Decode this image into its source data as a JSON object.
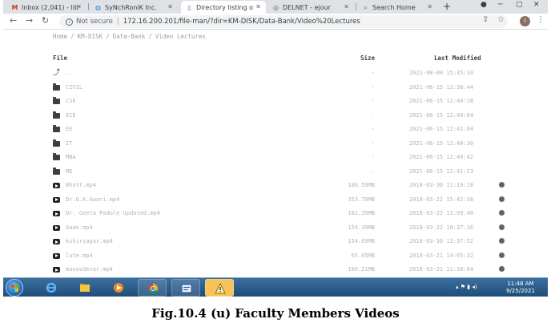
{
  "browser": {
    "tabs": [
      {
        "title": "Inbox (2,041) - lib",
        "favicon": "gmail-icon",
        "active": false
      },
      {
        "title": "SyNchRoniK Inc.",
        "favicon": "ovals-icon",
        "active": false
      },
      {
        "title": "Directory listing o",
        "favicon": "page-icon",
        "active": true
      },
      {
        "title": "DELNET - ejour",
        "favicon": "globe-icon",
        "active": false
      },
      {
        "title": "Search Home",
        "favicon": "search-icon",
        "active": false
      }
    ],
    "new_tab_label": "+",
    "security_label": "Not secure",
    "url": "172.16.200.201/file-man/?dir=KM-DISK/Data-Bank/Video%20Lectures",
    "profile_initial": "I"
  },
  "breadcrumb": [
    "Home",
    "KM-DISK",
    "Data-Bank",
    "Video Lectures"
  ],
  "table": {
    "headers": {
      "name": "File",
      "size": "Size",
      "modified": "Last Modified"
    },
    "rows": [
      {
        "type": "up",
        "name": "..",
        "size": "-",
        "modified": "2021-08-09 15:35:10"
      },
      {
        "type": "folder",
        "name": "CIVIL",
        "size": "-",
        "modified": "2021-06-15 12:36:44"
      },
      {
        "type": "folder",
        "name": "CSE",
        "size": "-",
        "modified": "2021-06-15 12:40:18"
      },
      {
        "type": "folder",
        "name": "ECE",
        "size": "-",
        "modified": "2021-06-15 12:40:04"
      },
      {
        "type": "folder",
        "name": "EE",
        "size": "-",
        "modified": "2021-06-15 12:41:04"
      },
      {
        "type": "folder",
        "name": "IT",
        "size": "-",
        "modified": "2021-06-15 12:40:30"
      },
      {
        "type": "folder",
        "name": "MBA",
        "size": "-",
        "modified": "2021-06-15 12:40:42"
      },
      {
        "type": "folder",
        "name": "ME",
        "size": "-",
        "modified": "2021-06-15 12:41:23"
      },
      {
        "type": "video",
        "name": "Bhatt.mp4",
        "size": "186.59MB",
        "modified": "2018-03-30 11:19:18"
      },
      {
        "type": "video",
        "name": "Dr.G.K.Awari.mp4",
        "size": "353.70MB",
        "modified": "2018-03-22 15:42:38"
      },
      {
        "type": "video",
        "name": "Dr. Geeta Padole Updated.mp4",
        "size": "161.39MB",
        "modified": "2018-03-22 13:09:40"
      },
      {
        "type": "video",
        "name": "Gade.mp4",
        "size": "154.39MB",
        "modified": "2018-03-22 10:37:16"
      },
      {
        "type": "video",
        "name": "kshirsagar.mp4",
        "size": "154.69MB",
        "modified": "2018-03-30 13:37:52"
      },
      {
        "type": "video",
        "name": "lute.mp4",
        "size": "65.05MB",
        "modified": "2018-03-21 14:05:32"
      },
      {
        "type": "video",
        "name": "manavdevar.mp4",
        "size": "160.21MB",
        "modified": "2018-03-21 11:30:04"
      }
    ]
  },
  "taskbar": {
    "apps": [
      "internet-explorer-icon",
      "file-explorer-icon",
      "media-player-icon",
      "chrome-icon",
      "powerpoint-icon",
      "warning-app-icon"
    ],
    "time": "11:48 AM",
    "date": "9/25/2021"
  },
  "caption": "Fig.10.4 (u) Faculty Members Videos"
}
